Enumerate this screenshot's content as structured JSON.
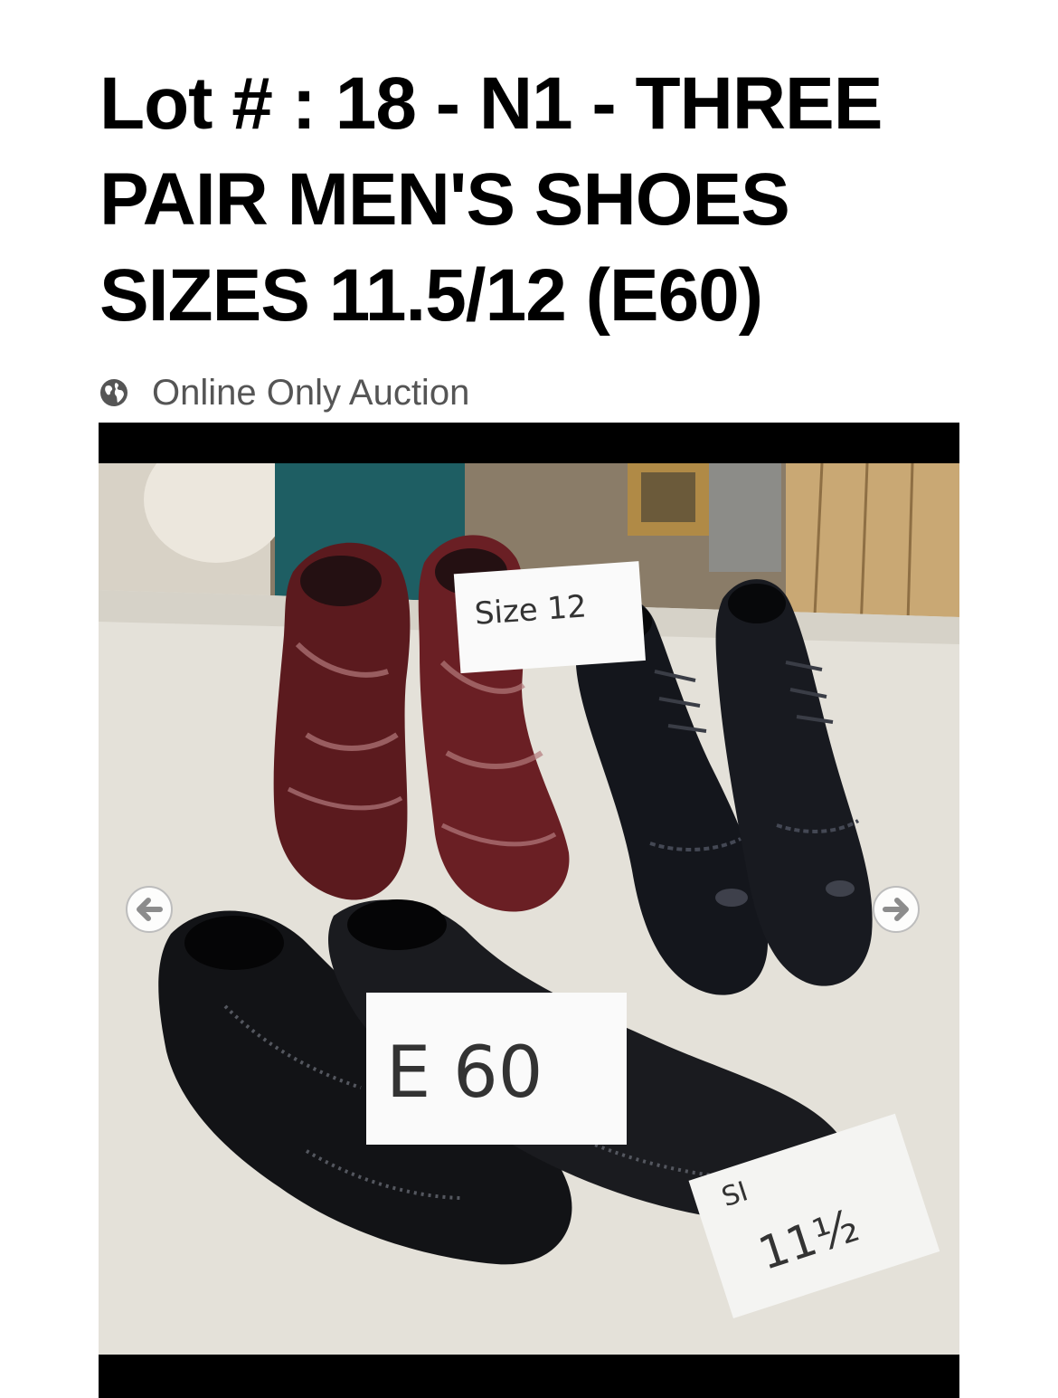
{
  "lot": {
    "title": "Lot # : 18 - N1 - THREE PAIR MEN'S SHOES SIZES 11.5/12 (E60)",
    "auction_type": "Online Only Auction",
    "auction_type_icon": "globe-icon"
  },
  "gallery": {
    "prev_icon": "arrow-left-icon",
    "next_icon": "arrow-right-icon",
    "photo_labels": {
      "size_card": "Size 12",
      "lot_card": "E 60",
      "size_card_small_partial": "SI",
      "size_card_small_value": "11½"
    }
  },
  "colors": {
    "title": "#000000",
    "subtitle": "#555555",
    "gallery_background": "#000000",
    "arrow_fill": "#ffffff"
  }
}
